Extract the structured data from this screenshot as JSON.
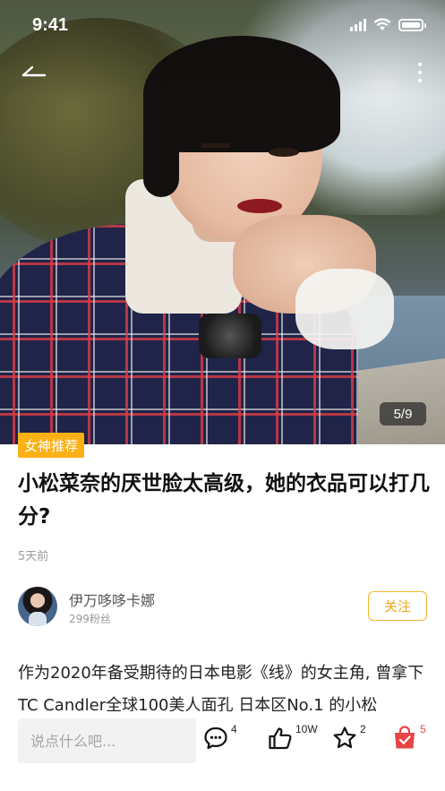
{
  "status_bar": {
    "time": "9:41"
  },
  "gallery": {
    "counter": "5/9"
  },
  "article": {
    "tag": "女神推荐",
    "title": "小松菜奈的厌世脸太高级，她的衣品可以打几分?",
    "time_ago": "5天前",
    "body": "作为2020年备受期待的日本电影《线》的女主角, 曾拿下TC Candler全球100美人面孔 日本区No.1 的小松"
  },
  "author": {
    "name": "伊万哆哆卡娜",
    "fans": "299粉丝",
    "follow_label": "关注"
  },
  "bottom_bar": {
    "comment_placeholder": "说点什么吧...",
    "comment_count": "4",
    "like_count": "10W",
    "favorite_count": "2",
    "shop_count": "5"
  },
  "colors": {
    "accent": "#fbb016",
    "shop_red": "#e64545"
  },
  "icons": [
    "back-arrow-icon",
    "more-vertical-icon",
    "comment-icon",
    "thumbs-up-icon",
    "star-icon",
    "shopping-bag-icon"
  ]
}
